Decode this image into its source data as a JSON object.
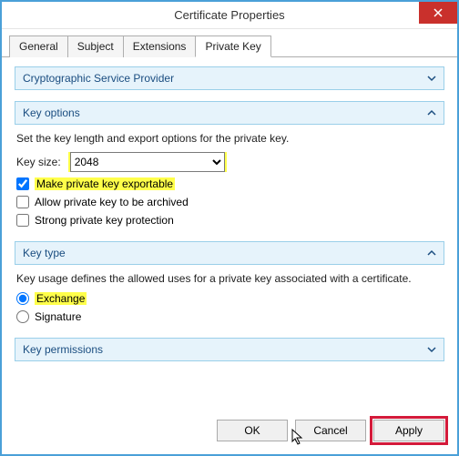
{
  "window": {
    "title": "Certificate Properties"
  },
  "tabs": {
    "general": "General",
    "subject": "Subject",
    "extensions": "Extensions",
    "private_key": "Private Key"
  },
  "sections": {
    "csp": {
      "title": "Cryptographic Service Provider"
    },
    "key_options": {
      "title": "Key options",
      "desc": "Set the key length and export options for the private key.",
      "key_size_label": "Key size:",
      "key_size_value": "2048",
      "exportable": "Make private key exportable",
      "archive": "Allow private key to be archived",
      "strong": "Strong private key protection"
    },
    "key_type": {
      "title": "Key type",
      "desc": "Key usage defines the allowed uses for a private key associated with a certificate.",
      "exchange": "Exchange",
      "signature": "Signature"
    },
    "key_permissions": {
      "title": "Key permissions"
    }
  },
  "buttons": {
    "ok": "OK",
    "cancel": "Cancel",
    "apply": "Apply"
  }
}
